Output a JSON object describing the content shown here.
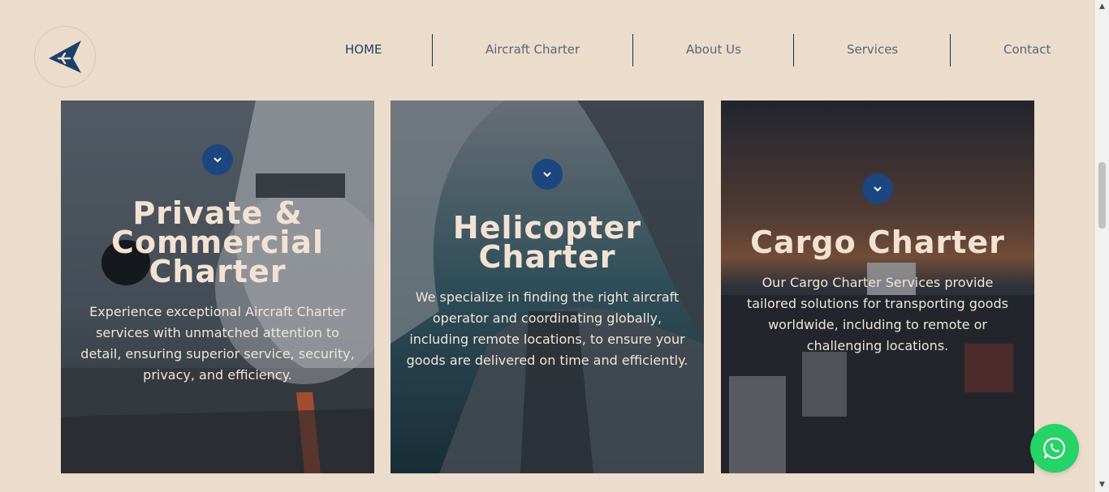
{
  "nav": {
    "items": [
      {
        "label": "HOME",
        "active": true
      },
      {
        "label": "Aircraft Charter",
        "active": false
      },
      {
        "label": "About Us",
        "active": false
      },
      {
        "label": "Services",
        "active": false
      },
      {
        "label": "Contact",
        "active": false
      }
    ]
  },
  "cards": [
    {
      "title_lines": [
        "Private &",
        "Commercial",
        "Charter"
      ],
      "text": "Experience exceptional Aircraft Charter services with unmatched attention to detail, ensuring superior service, security, privacy, and efficiency."
    },
    {
      "title_lines": [
        "Helicopter",
        "Charter"
      ],
      "text": "We specialize in finding the right aircraft operator and coordinating globally, including remote locations, to ensure your goods are delivered on time and efficiently."
    },
    {
      "title_lines": [
        "Cargo Charter"
      ],
      "text": "Our Cargo Charter Services provide tailored solutions for transporting goods worldwide, including to remote or challenging locations."
    }
  ],
  "colors": {
    "page_bg": "#ecdccb",
    "accent": "#1c4680",
    "nav_active": "#1d3f6d",
    "whatsapp": "#25d366"
  }
}
